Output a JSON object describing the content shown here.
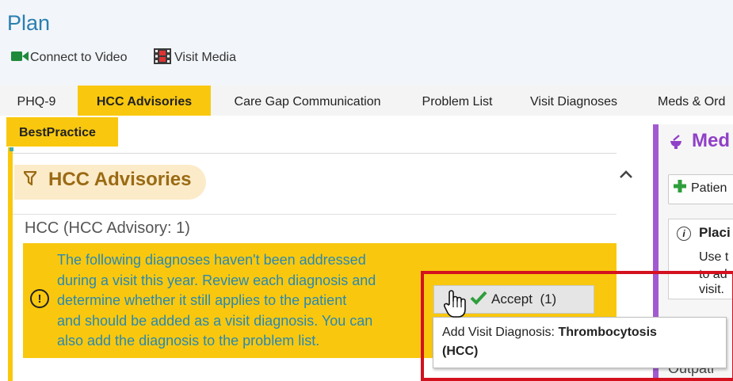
{
  "header": {
    "title": "Plan",
    "connect_video_label": "Connect to Video",
    "visit_media_label": "Visit Media"
  },
  "tabs": [
    {
      "label": "PHQ-9",
      "active": false
    },
    {
      "label": "HCC Advisories",
      "active": true
    },
    {
      "label": "Care Gap Communication",
      "active": false
    },
    {
      "label": "Problem List",
      "active": false
    },
    {
      "label": "Visit Diagnoses",
      "active": false
    },
    {
      "label": "Meds & Ord",
      "active": false
    }
  ],
  "subtab": {
    "label": "BestPractice"
  },
  "section": {
    "title": "HCC Advisories",
    "subtitle": "HCC (HCC Advisory: 1)",
    "notice_lines": [
      "The following diagnoses haven't been addressed",
      "during a visit this year. Review each diagnosis and",
      "determine whether it still applies to the patient",
      "and should be added as a visit diagnosis. You can",
      "also add the diagnosis to the problem list."
    ]
  },
  "accept": {
    "label": "Accept",
    "count": "(1)"
  },
  "tooltip": {
    "prefix": "Add Visit Diagnosis: ",
    "diagnosis": "Thrombocytosis",
    "tag": "(HCC)"
  },
  "right_panel": {
    "title": "Med",
    "patient_button": "Patien",
    "placi_title": "Placi",
    "placi_lines": [
      "Use t",
      "to ad",
      "visit."
    ],
    "outpati": "Outpati"
  },
  "colors": {
    "accent_yellow": "#f9c80e",
    "title_blue": "#2a7fb0",
    "notice_text": "#2a88b2",
    "purple": "#a25ad1",
    "highlight_red": "#d3111f",
    "check_green": "#2e9e3c"
  },
  "icons": {
    "video": "video-camera-icon",
    "media": "film-icon",
    "section": "filter-icon",
    "notice": "exclamation-circle-icon",
    "accept": "checkmark-icon",
    "collapse": "chevron-up-icon",
    "meds": "pestle-icon",
    "add": "plus-icon",
    "info": "info-circle-icon",
    "cursor": "hand-pointer-icon"
  }
}
